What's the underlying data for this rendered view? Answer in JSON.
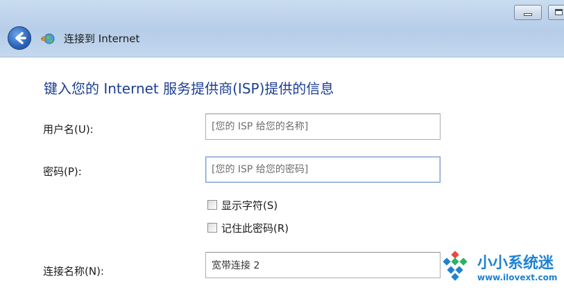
{
  "window": {
    "title": "连接到 Internet",
    "controls": [
      "minimize",
      "maximize"
    ]
  },
  "heading": "键入您的 Internet 服务提供商(ISP)提供的信息",
  "form": {
    "username": {
      "label": "用户名(U):",
      "placeholder": "[您的 ISP 给您的名称]",
      "value": ""
    },
    "password": {
      "label": "密码(P):",
      "placeholder": "[您的 ISP 给您的密码]",
      "value": ""
    },
    "show_characters": {
      "label": "显示字符(S)",
      "checked": false
    },
    "remember_password": {
      "label": "记住此密码(R)",
      "checked": false
    },
    "connection_name": {
      "label": "连接名称(N):",
      "value": "宽带连接 2"
    }
  },
  "watermark": {
    "name": "小小系统迷",
    "url": "www.ilovext.com"
  },
  "colors": {
    "heading": "#1c3f94",
    "titlebar": "#c4d8ee",
    "watermark": "#1e82d2"
  },
  "icons": [
    "minimize-icon",
    "maximize-icon",
    "back-arrow-icon",
    "network-globe-icon",
    "checkbox-icon",
    "watermark-logo"
  ]
}
